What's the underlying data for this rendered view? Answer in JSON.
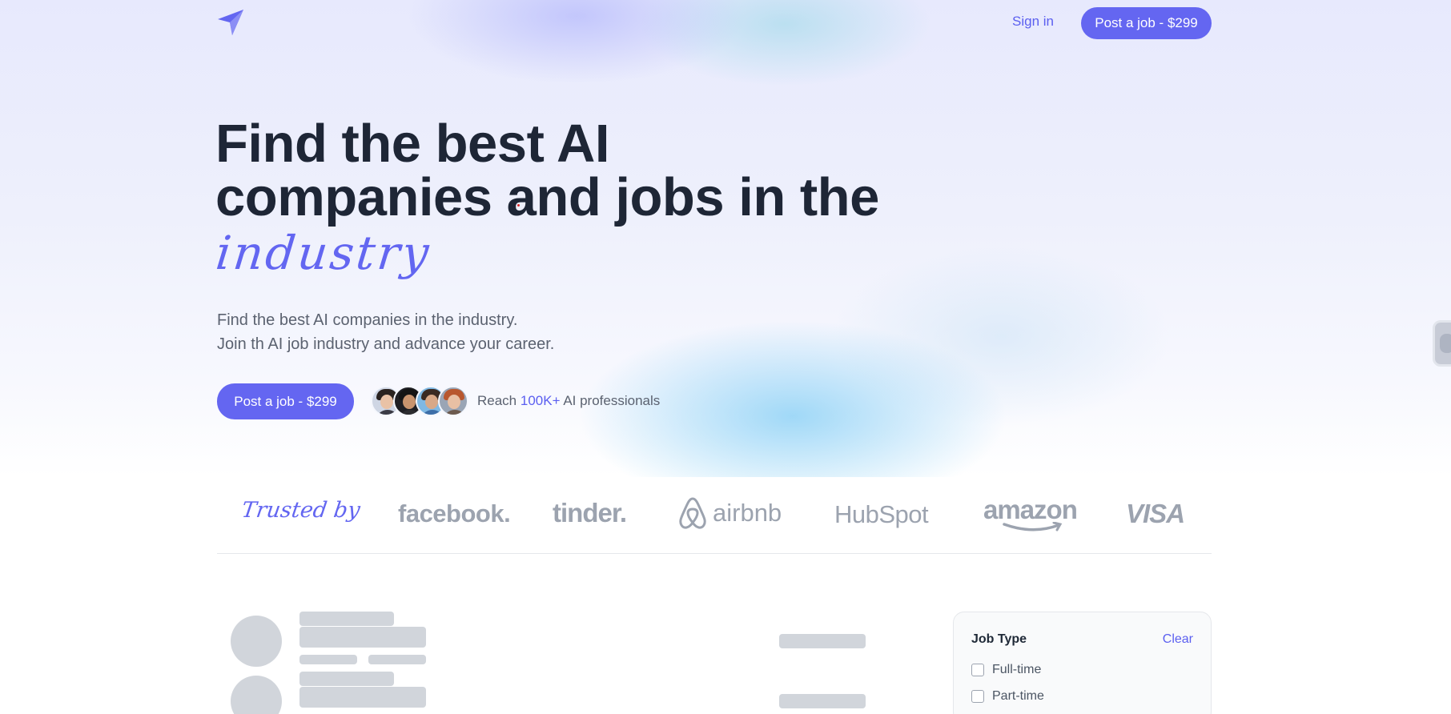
{
  "nav": {
    "logo_icon": "paper-plane-icon",
    "signin_label": "Sign in",
    "post_job_label": "Post a job - $299"
  },
  "hero": {
    "headline_line1": "Find the best AI",
    "headline_line2": "companies and jobs in the",
    "headline_script": "industry",
    "sub_line1": "Find the best AI companies in the industry.",
    "sub_line2": "Join th AI job industry and advance your career.",
    "cta_label": "Post a job - $299",
    "reach_prefix": "Reach",
    "reach_count": "100K+",
    "reach_suffix": "AI professionals"
  },
  "trusted": {
    "label": "Trusted by",
    "logos": [
      "facebook.",
      "tinder.",
      "airbnb",
      "HubSpot",
      "amazon",
      "VISA"
    ]
  },
  "filter": {
    "title": "Job Type",
    "clear_label": "Clear",
    "options": [
      "Full-time",
      "Part-time"
    ]
  },
  "colors": {
    "accent": "#6466f1",
    "heading": "#1e2636",
    "muted": "#5b6270",
    "logo_gray": "#9ca3af",
    "skeleton": "#d1d5db"
  }
}
